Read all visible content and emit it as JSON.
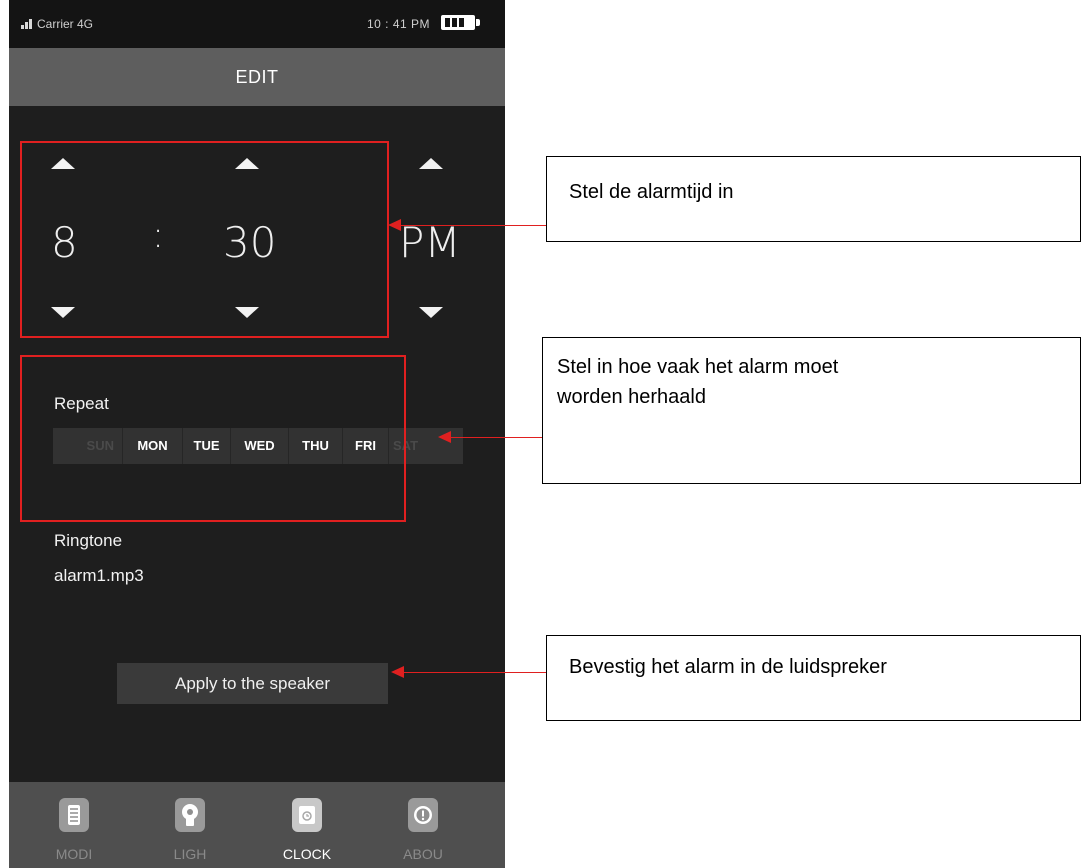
{
  "status_bar": {
    "carrier": "Carrier 4G",
    "time": "10 : 41 PM"
  },
  "header": {
    "title": "EDIT"
  },
  "time_picker": {
    "hour": "8",
    "separator": ":",
    "minute": "30",
    "period": "PM"
  },
  "repeat": {
    "label": "Repeat",
    "days": [
      {
        "label": "SUN",
        "active": false
      },
      {
        "label": "MON",
        "active": true
      },
      {
        "label": "TUE",
        "active": true
      },
      {
        "label": "WED",
        "active": true
      },
      {
        "label": "THU",
        "active": true
      },
      {
        "label": "FRI",
        "active": true
      },
      {
        "label": "SAT",
        "active": false
      }
    ]
  },
  "ringtone": {
    "label": "Ringtone",
    "value": "alarm1.mp3"
  },
  "apply_button": {
    "label": "Apply to the speaker"
  },
  "tabs": [
    {
      "label": "MODI",
      "icon": "mode-icon",
      "active": false
    },
    {
      "label": "LIGH",
      "icon": "bulb-icon",
      "active": false
    },
    {
      "label": "CLOCK",
      "icon": "alarm-clock-icon",
      "active": true
    },
    {
      "label": "ABOU",
      "icon": "info-icon",
      "active": false
    }
  ],
  "callouts": {
    "time": "Stel de alarmtijd in",
    "repeat": "Stel in hoe vaak het alarm moet worden herhaald",
    "apply": "Bevestig het alarm in de luidspreker"
  },
  "colors": {
    "annotation": "#e02020",
    "phone_bg": "#1e1e1e",
    "header_bg": "#5e5e5e"
  }
}
